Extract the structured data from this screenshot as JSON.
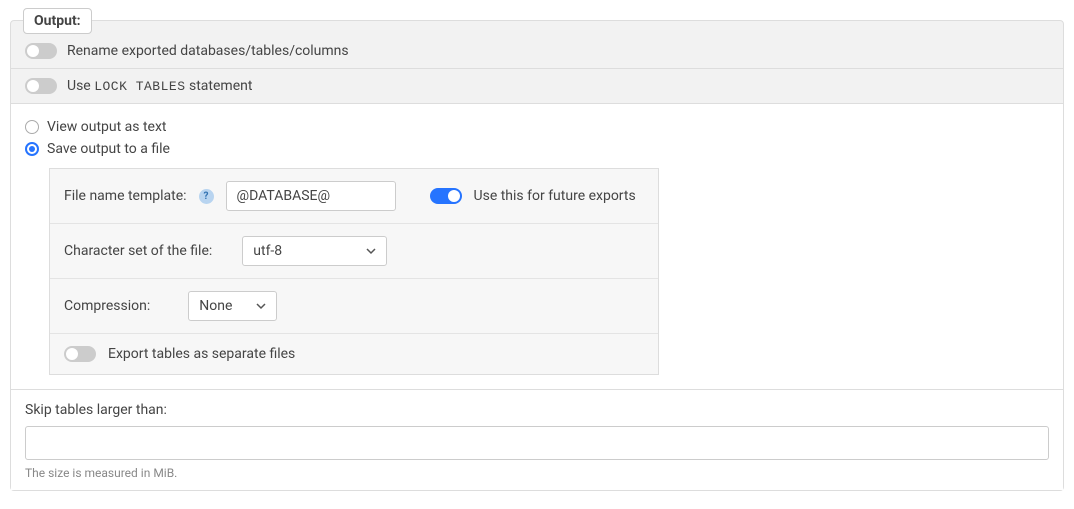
{
  "legend": "Output:",
  "rename": {
    "label": "Rename exported databases/tables/columns",
    "enabled": false
  },
  "lockTables": {
    "prefix": "Use ",
    "code": "LOCK TABLES",
    "suffix": " statement",
    "enabled": false
  },
  "outputMode": {
    "viewText": "View output as text",
    "saveFile": "Save output to a file",
    "selected": "saveFile"
  },
  "fileTemplate": {
    "label": "File name template:",
    "value": "@DATABASE@",
    "future": {
      "label": "Use this for future exports",
      "enabled": true
    }
  },
  "charset": {
    "label": "Character set of the file:",
    "value": "utf-8"
  },
  "compression": {
    "label": "Compression:",
    "value": "None"
  },
  "separateFiles": {
    "label": "Export tables as separate files",
    "enabled": false
  },
  "skip": {
    "label": "Skip tables larger than:",
    "value": "",
    "hint": "The size is measured in MiB."
  }
}
